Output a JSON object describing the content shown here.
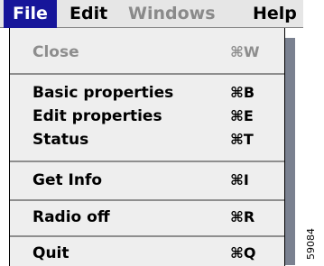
{
  "menubar": {
    "file": "File",
    "edit": "Edit",
    "windows": "Windows",
    "help": "Help"
  },
  "file_menu": {
    "items": [
      {
        "label": "Close",
        "shortcut": "⌘W",
        "enabled": false
      },
      {
        "label": "Basic properties",
        "shortcut": "⌘B",
        "enabled": true
      },
      {
        "label": "Edit properties",
        "shortcut": "⌘E",
        "enabled": true
      },
      {
        "label": "Status",
        "shortcut": "⌘T",
        "enabled": true
      },
      {
        "label": "Get Info",
        "shortcut": "⌘I",
        "enabled": true
      },
      {
        "label": "Radio off",
        "shortcut": "⌘R",
        "enabled": true
      },
      {
        "label": "Quit",
        "shortcut": "⌘Q",
        "enabled": true
      }
    ]
  },
  "figure_number": "59084",
  "colors": {
    "active_menu": "#17169a",
    "disabled_text": "#8d8d8d",
    "menu_background": "#eeeeee"
  }
}
